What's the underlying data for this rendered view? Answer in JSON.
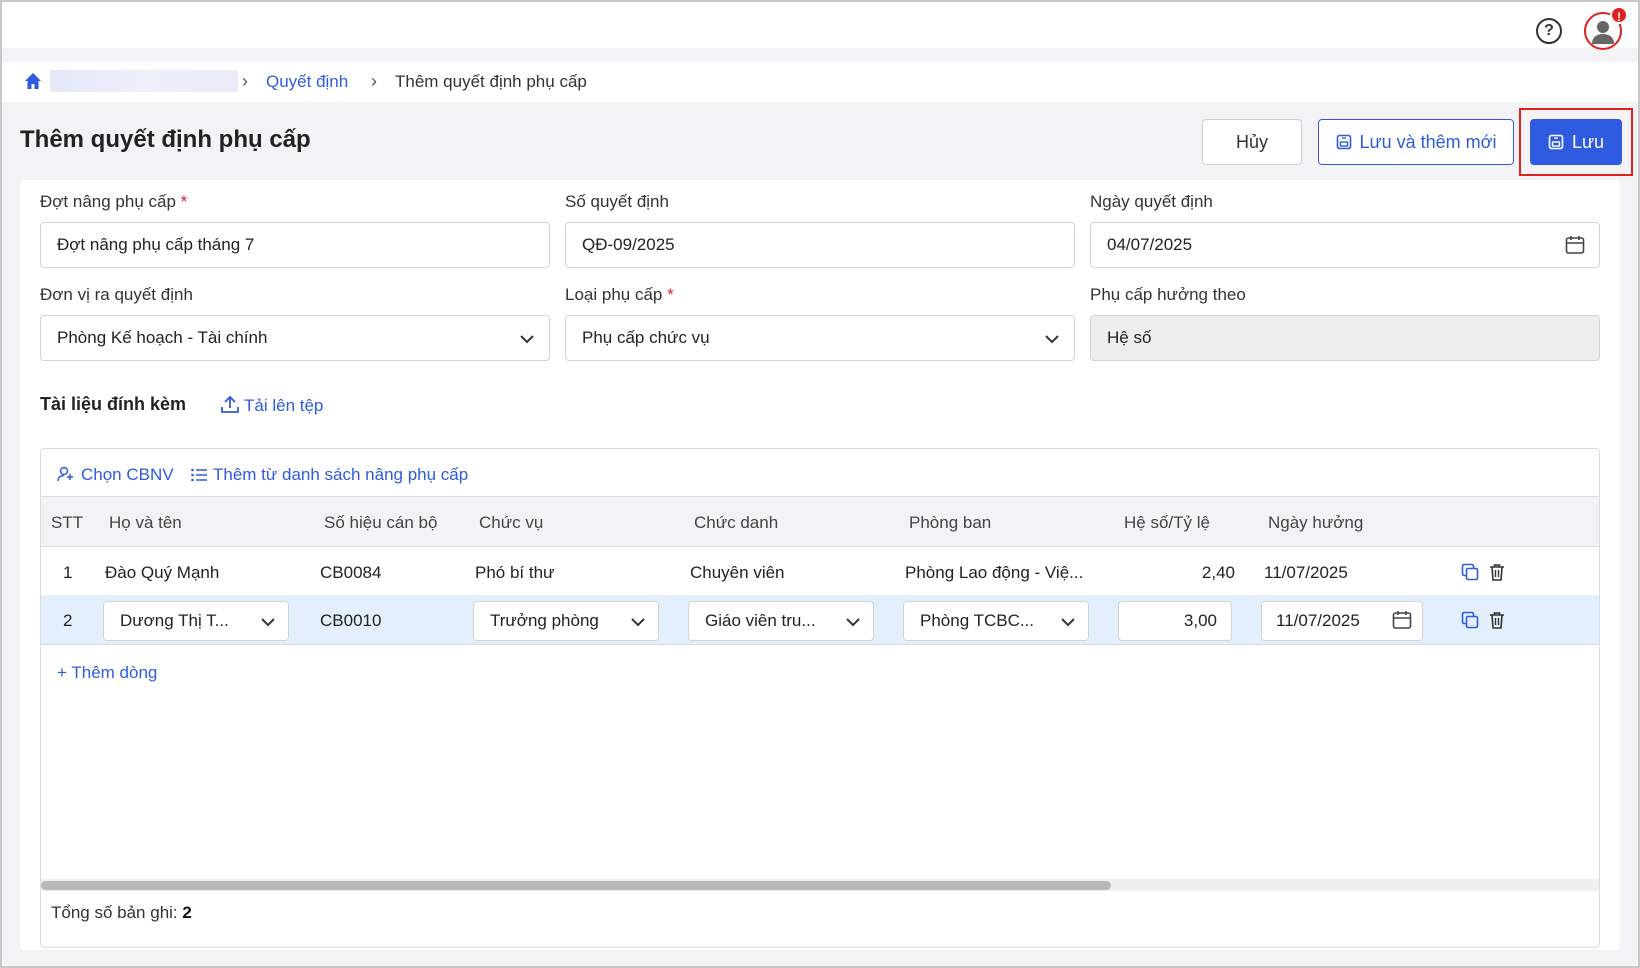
{
  "header": {
    "help_icon": "question-circle-icon",
    "avatar_icon": "user-avatar-icon",
    "notification_badge": "!"
  },
  "breadcrumb": {
    "level1": "Quyết định",
    "current": "Thêm quyết định phụ cấp"
  },
  "page": {
    "title": "Thêm quyết định phụ cấp"
  },
  "actions": {
    "cancel": "Hủy",
    "save_and_new": "Lưu và thêm mới",
    "save": "Lưu"
  },
  "form": {
    "dot_nang_label": "Đợt nâng phụ cấp",
    "dot_nang_value": "Đợt nâng phụ cấp tháng 7",
    "so_qd_label": "Số quyết định",
    "so_qd_value": "QĐ-09/2025",
    "ngay_qd_label": "Ngày quyết định",
    "ngay_qd_value": "04/07/2025",
    "don_vi_label": "Đơn vị ra quyết định",
    "don_vi_value": "Phòng Kế hoạch - Tài chính",
    "loai_pc_label": "Loại phụ cấp",
    "loai_pc_value": "Phụ cấp chức vụ",
    "huong_theo_label": "Phụ cấp hưởng theo",
    "huong_theo_value": "Hệ số",
    "required_mark": "*"
  },
  "attachments": {
    "title": "Tài liệu đính kèm",
    "upload": "Tải lên tệp"
  },
  "grid": {
    "choose_staff": "Chọn CBNV",
    "add_from_list": "Thêm từ danh sách nâng phụ cấp",
    "columns": [
      "STT",
      "Họ và tên",
      "Số hiệu cán bộ",
      "Chức vụ",
      "Chức danh",
      "Phòng ban",
      "Hệ số/Tỷ lệ",
      "Ngày hưởng"
    ],
    "rows": [
      {
        "stt": "1",
        "name": "Đào Quý Mạnh",
        "code": "CB0084",
        "position": "Phó bí thư",
        "title": "Chuyên viên",
        "dept": "Phòng Lao động - Việ...",
        "coef": "2,40",
        "date": "11/07/2025"
      },
      {
        "stt": "2",
        "name": "Dương Thị T...",
        "code": "CB0010",
        "position": "Trưởng phòng",
        "title": "Giáo viên tru...",
        "dept": "Phòng TCBC...",
        "coef": "3,00",
        "date": "11/07/2025"
      }
    ],
    "add_row": "Thêm dòng",
    "total_label": "Tổng số bản ghi:",
    "total_value": "2"
  },
  "colors": {
    "accent": "#2f5be0",
    "danger": "#e02020",
    "selected_row": "#e3effd"
  }
}
